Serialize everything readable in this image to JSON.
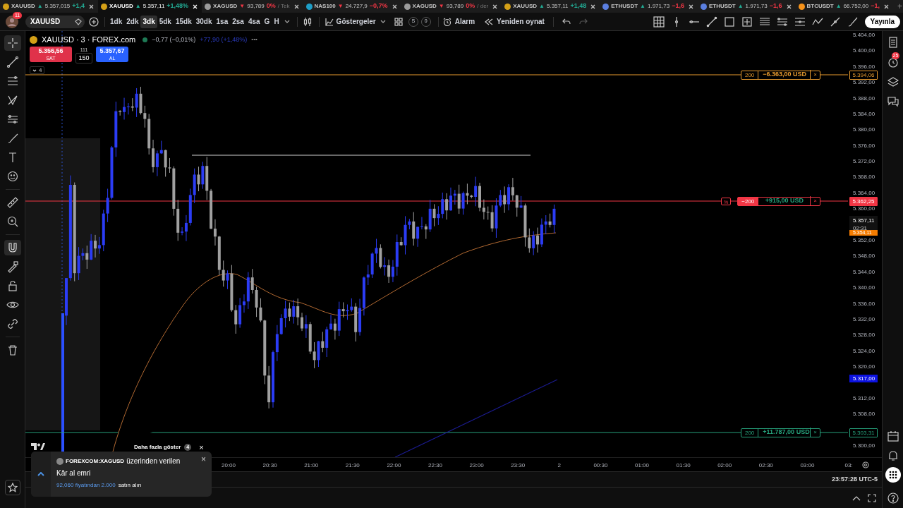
{
  "tabs": [
    {
      "kind": "gold",
      "symbol": "XAUUSD",
      "arrow": {
        "text": "▲",
        "color": "#22ab94"
      },
      "price": "5.357,015",
      "change": {
        "text": "+1,4",
        "color": "#22ab94"
      },
      "selected": false
    },
    {
      "kind": "gold",
      "symbol": "XAUUSD",
      "arrow": {
        "text": "▲",
        "color": "#22ab94"
      },
      "price": "5.357,11",
      "change": {
        "text": "+1,48%",
        "color": "#22ab94"
      },
      "selected": true
    },
    {
      "kind": "silver",
      "symbol": "XAGUSD",
      "arrow": {
        "text": "▼",
        "color": "#f23645"
      },
      "price": "93,789",
      "change": {
        "text": "0%",
        "color": "#f23645"
      },
      "extra": "/ Tek",
      "selected": false
    },
    {
      "kind": "index",
      "symbol": "NAS100",
      "arrow": {
        "text": "▼",
        "color": "#f23645"
      },
      "price": "24.727,9",
      "change": {
        "text": "−0,7%",
        "color": "#f23645"
      },
      "selected": false
    },
    {
      "kind": "silver",
      "symbol": "XAGUSD",
      "arrow": {
        "text": "▼",
        "color": "#f23645"
      },
      "price": "93,789",
      "change": {
        "text": "0%",
        "color": "#f23645"
      },
      "extra": "/ der",
      "selected": false
    },
    {
      "kind": "gold",
      "symbol": "XAUUSD",
      "arrow": {
        "text": "▲",
        "color": "#22ab94"
      },
      "price": "5.357,11",
      "change": {
        "text": "+1,48",
        "color": "#22ab94"
      },
      "selected": false
    },
    {
      "kind": "eth",
      "symbol": "ETHUSDT",
      "arrow": {
        "text": "▲",
        "color": "#22ab94"
      },
      "price": "1.971,73",
      "change": {
        "text": "−1,6",
        "color": "#f23645"
      },
      "selected": false
    },
    {
      "kind": "eth",
      "symbol": "ETHUSDT",
      "arrow": {
        "text": "▲",
        "color": "#22ab94"
      },
      "price": "1.971,73",
      "change": {
        "text": "−1,6",
        "color": "#f23645"
      },
      "selected": false
    },
    {
      "kind": "btc",
      "symbol": "BTCUSDT",
      "arrow": {
        "text": "▲",
        "color": "#22ab94"
      },
      "price": "66.752,00",
      "change": {
        "text": "−1,",
        "color": "#f23645"
      },
      "selected": false
    }
  ],
  "tab_add": "+",
  "toolbar": {
    "symbol": "XAUUSD",
    "notifications": "11",
    "intervals": [
      {
        "label": "1dk",
        "selected": false
      },
      {
        "label": "2dk",
        "selected": false
      },
      {
        "label": "3dk",
        "selected": true
      },
      {
        "label": "5dk",
        "selected": false
      },
      {
        "label": "15dk",
        "selected": false
      },
      {
        "label": "30dk",
        "selected": false
      },
      {
        "label": "1sa",
        "selected": false
      },
      {
        "label": "2sa",
        "selected": false
      },
      {
        "label": "4sa",
        "selected": false
      },
      {
        "label": "G",
        "selected": false
      },
      {
        "label": "H",
        "selected": false
      }
    ],
    "indicators": "Göstergeler",
    "counters": [
      "S",
      "0"
    ],
    "alarm": "Alarm",
    "replay": "Yeniden oynat",
    "publish": "Yayınla"
  },
  "left_toolbar": [
    {
      "kind": "crosshair",
      "selected": true
    },
    {
      "kind": "trendline",
      "selected": false
    },
    {
      "kind": "fib",
      "selected": false
    },
    {
      "kind": "pattern",
      "selected": false
    },
    {
      "kind": "forecast",
      "selected": false
    },
    {
      "kind": "brush",
      "selected": false
    },
    {
      "kind": "text",
      "selected": false
    },
    {
      "kind": "emoji",
      "selected": false
    },
    {
      "kind": "ruler",
      "selected": false
    },
    {
      "kind": "zoom",
      "selected": false
    },
    {
      "kind": "magnet",
      "selected": true
    },
    {
      "kind": "lockdraw",
      "selected": false
    },
    {
      "kind": "lock",
      "selected": false
    },
    {
      "kind": "eye",
      "selected": false
    },
    {
      "kind": "link",
      "selected": false
    },
    {
      "kind": "trash",
      "selected": false
    }
  ],
  "legend": {
    "title": "XAUUSD · 3 · FOREX.com",
    "market_open": true,
    "change": "−0,77 (−0,01%)",
    "day_change": "+77,90 (+1,48%)",
    "more": "•••"
  },
  "trade": {
    "sell_price": "5.356,56",
    "sell_label": "SAT",
    "spread": "111",
    "quantity": "150",
    "buy_price": "5.357,67",
    "buy_label": "AL"
  },
  "indicators_toggle": {
    "count": "4",
    "expanded": false
  },
  "orders": [
    {
      "kind": "order",
      "color": "#e89b2f",
      "quantity": "200",
      "pnl": {
        "text": "−6.363,00 USD",
        "color": "#e89b2f"
      },
      "close": "×",
      "price": "5.394,06"
    },
    {
      "kind": "position",
      "color": "#f23645",
      "percent": "%",
      "quantity": "−200",
      "pnl": {
        "text": "+915,00 USD",
        "color": "#26a17b"
      },
      "close": "×",
      "price": "5.362,25"
    },
    {
      "kind": "order",
      "color": "#26a17b",
      "quantity": "200",
      "pnl": {
        "text": "+11.787,00 USD",
        "color": "#26a17b"
      },
      "close": "×",
      "price": "5.303,31"
    }
  ],
  "price_axis": {
    "ticks": [
      "5.404,00",
      "5.400,00",
      "5.396,00",
      "5.392,00",
      "5.388,00",
      "5.384,00",
      "5.380,00",
      "5.376,00",
      "5.372,00",
      "5.368,00",
      "5.364,00",
      "5.360,00",
      "5.352,00",
      "5.348,00",
      "5.344,00",
      "5.340,00",
      "5.336,00",
      "5.332,00",
      "5.328,00",
      "5.324,00",
      "5.320,00",
      "5.312,00",
      "5.308,00",
      "5.300,00"
    ],
    "last_price": "5.357,11",
    "countdown": "02:31",
    "ma_price": "5.354,11",
    "line_price": "5.317,00"
  },
  "time_axis": {
    "ticks": [
      "20:00",
      "20:30",
      "21:00",
      "21:30",
      "22:00",
      "22:30",
      "23:00",
      "23:30",
      "2",
      "00:30",
      "01:00",
      "01:30",
      "02:00",
      "02:30",
      "03:00",
      "03:"
    ]
  },
  "status_bar": {
    "clock": "23:57:28 UTC-5"
  },
  "notifications": {
    "more": "Daha fazla göster",
    "count": "4",
    "close": "×",
    "toast": {
      "source": "FOREXCOM:XAGUSD",
      "text": "üzerinden verilen",
      "title": "Kâr al emri",
      "detail": "92,060 fiyatından 2.000",
      "action": "satın alın",
      "close": "×"
    }
  },
  "right_sidebar": {
    "alerts_badge": "25"
  }
}
